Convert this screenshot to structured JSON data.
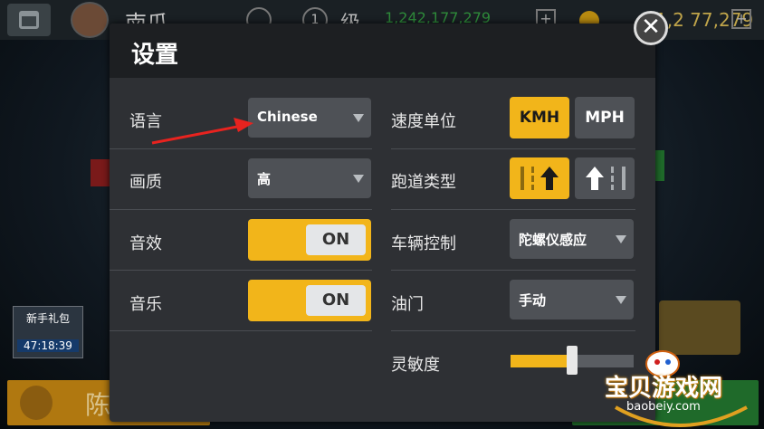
{
  "hud": {
    "player_name": "南瓜",
    "level_number": "1",
    "level_label": "级",
    "cash": "1,242,177,279",
    "gold": "1,2  77,279",
    "plus": "+"
  },
  "bottom": {
    "left_label": "陈列室"
  },
  "gift": {
    "title": "新手礼包",
    "timer": "47:18:39"
  },
  "dialog": {
    "title": "设置",
    "close_glyph": "✕",
    "left_rows": [
      {
        "label": "语言",
        "value": "Chinese"
      },
      {
        "label": "画质",
        "value": "高"
      },
      {
        "label": "音效",
        "toggle": "ON"
      },
      {
        "label": "音乐",
        "toggle": "ON"
      }
    ],
    "right_rows": [
      {
        "label": "速度单位",
        "options": [
          "KMH",
          "MPH"
        ],
        "selected": "KMH"
      },
      {
        "label": "跑道类型",
        "selected_index": 0
      },
      {
        "label": "车辆控制",
        "value": "陀螺仪感应"
      },
      {
        "label": "油门",
        "value": "手动"
      },
      {
        "label": "灵敏度",
        "slider_value": 0.5
      }
    ]
  },
  "watermark": {
    "title": "宝贝游戏网",
    "sub": "baobeiy.com"
  },
  "colors": {
    "accent": "#f2b51a",
    "panel": "#2e3034",
    "control": "#4e5156",
    "arrow": "#e8231f"
  },
  "icons": [
    "calendar-icon",
    "avatar",
    "cash-icon",
    "coin-icon",
    "plus-icon",
    "close-icon",
    "caret-down-icon",
    "lane-arrow-icon",
    "gear-icon",
    "gamepad-logo"
  ]
}
